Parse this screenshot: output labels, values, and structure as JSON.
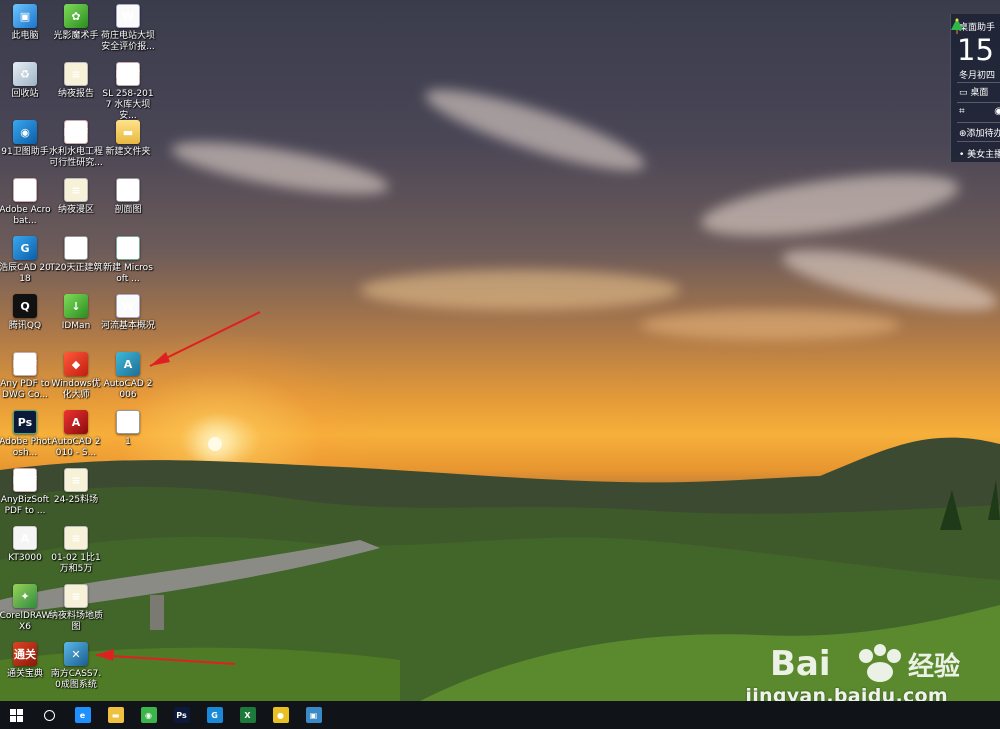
{
  "desktop": {
    "icons": [
      {
        "label": "此电脑",
        "icon": "computer-icon",
        "glyph": "▣",
        "cls": "g-pc"
      },
      {
        "label": "光影魔术手",
        "icon": "photo-editor-icon",
        "glyph": "✿",
        "cls": "g-green"
      },
      {
        "label": "荷庄电站大坝安全评价报...",
        "icon": "word-document-icon",
        "glyph": "W",
        "cls": "g-doc"
      },
      {
        "label": "回收站",
        "icon": "recycle-bin-icon",
        "glyph": "♻",
        "cls": "g-bin"
      },
      {
        "label": "纳夜报告",
        "icon": "text-file-icon",
        "glyph": "≡",
        "cls": "g-text"
      },
      {
        "label": "SL 258-2017 水库大坝安...",
        "icon": "pdf-document-icon",
        "glyph": "PDF",
        "cls": "g-pdf"
      },
      {
        "label": "91卫图助手",
        "icon": "satellite-map-icon",
        "glyph": "◉",
        "cls": "g-blue"
      },
      {
        "label": "水利水电工程可行性研究...",
        "icon": "pdf-document-icon",
        "glyph": "PDF",
        "cls": "g-pdf"
      },
      {
        "label": "新建文件夹",
        "icon": "folder-icon",
        "glyph": "▬",
        "cls": "g-folder"
      },
      {
        "label": "Adobe Acrobat...",
        "icon": "acrobat-icon",
        "glyph": "A",
        "cls": "g-pdf"
      },
      {
        "label": "纳夜漫区",
        "icon": "text-file-icon",
        "glyph": "≡",
        "cls": "g-text"
      },
      {
        "label": "剖面图",
        "icon": "image-file-icon",
        "glyph": "▀",
        "cls": "g-white"
      },
      {
        "label": "浩辰CAD 2018",
        "icon": "gstarcad-icon",
        "glyph": "G",
        "cls": "g-blue"
      },
      {
        "label": "T20天正建筑",
        "icon": "tangent-arch-icon",
        "glyph": "T",
        "cls": "g-white"
      },
      {
        "label": "新建 Microsoft ...",
        "icon": "excel-document-icon",
        "glyph": "X",
        "cls": "g-xls"
      },
      {
        "label": "腾讯QQ",
        "icon": "qq-penguin-icon",
        "glyph": "Q",
        "cls": "g-qq"
      },
      {
        "label": "IDMan",
        "icon": "download-manager-icon",
        "glyph": "↓",
        "cls": "g-green"
      },
      {
        "label": "河流基本概况",
        "icon": "word-document-icon",
        "glyph": "W",
        "cls": "g-doc"
      },
      {
        "label": "Any PDF to DWG Co...",
        "icon": "pdf-converter-icon",
        "glyph": "PDF",
        "cls": "g-pdf"
      },
      {
        "label": "Windows优化大师",
        "icon": "optimizer-shield-icon",
        "glyph": "◆",
        "cls": "g-red"
      },
      {
        "label": "AutoCAD 2006",
        "icon": "autocad-2006-icon",
        "glyph": "A",
        "cls": "g-teal"
      },
      {
        "label": "Adobe Photosh...",
        "icon": "photoshop-icon",
        "glyph": "Ps",
        "cls": "g-ps"
      },
      {
        "label": "AutoCAD 2010 - S...",
        "icon": "autocad-2010-icon",
        "glyph": "A",
        "cls": "g-cad"
      },
      {
        "label": "1",
        "icon": "image-file-icon",
        "glyph": "▄",
        "cls": "g-white"
      },
      {
        "label": "AnyBizSoft PDF to ...",
        "icon": "pdf-converter-icon",
        "glyph": "PDF",
        "cls": "g-pdf"
      },
      {
        "label": "24-25料场",
        "icon": "text-file-icon",
        "glyph": "≡",
        "cls": "g-text"
      },
      {
        "label": "KT3000",
        "icon": "kt3000-icon",
        "glyph": "A",
        "cls": "g-kt"
      },
      {
        "label": "01-02 1比1万和5万",
        "icon": "text-file-icon",
        "glyph": "≡",
        "cls": "g-text"
      },
      {
        "label": "CorelDRAW X6",
        "icon": "coreldraw-icon",
        "glyph": "✦",
        "cls": "g-corel"
      },
      {
        "label": "纳夜料场地质图",
        "icon": "text-file-icon",
        "glyph": "≡",
        "cls": "g-text"
      },
      {
        "label": "通关宝典",
        "icon": "tongguan-book-icon",
        "glyph": "通关",
        "cls": "g-tongguan"
      },
      {
        "label": "南方CASS7.0成图系统",
        "icon": "south-cass-icon",
        "glyph": "✕",
        "cls": "g-nanfang"
      }
    ],
    "watermark": {
      "url": "jingyan.baidu.com"
    }
  },
  "widget": {
    "title": "桌面助手",
    "day": "15",
    "lunar": "冬月初四",
    "desktop_label": "桌面",
    "add_todo": "添加待办",
    "beauty": "美女主播"
  },
  "taskbar": {
    "apps": [
      {
        "icon": "edge-browser-icon",
        "glyph": "e",
        "color": "#1e90ff"
      },
      {
        "icon": "file-explorer-icon",
        "glyph": "▬",
        "color": "#f0c040"
      },
      {
        "icon": "360-browser-icon",
        "glyph": "◉",
        "color": "#3cb54a"
      },
      {
        "icon": "photoshop-icon",
        "glyph": "Ps",
        "color": "#0c1a3a"
      },
      {
        "icon": "gstarcad-icon",
        "glyph": "G",
        "color": "#1a8ad8"
      },
      {
        "icon": "excel-icon",
        "glyph": "X",
        "color": "#1d7a3a"
      },
      {
        "icon": "hand-tool-icon",
        "glyph": "●",
        "color": "#e8c020"
      },
      {
        "icon": "image-viewer-icon",
        "glyph": "▣",
        "color": "#3a8ac8"
      }
    ]
  }
}
